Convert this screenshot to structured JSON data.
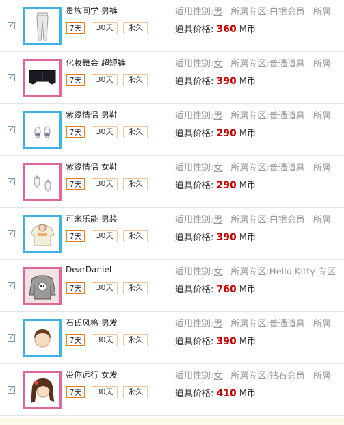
{
  "gender_label": "适用性别:",
  "zone_label": "所属专区:",
  "price_label": "道具价格:",
  "currency": "M币",
  "durations": {
    "d7": "7天",
    "d30": "30天",
    "perm": "永久"
  },
  "checkbox_mark": "✓",
  "items": [
    {
      "name": "贵族同学 男裤",
      "gender": "男",
      "zone": "白银会员",
      "zone_next": "所属",
      "price": "360",
      "frame": "blue",
      "icon": "pants-icon"
    },
    {
      "name": "化妆舞会 超短裤",
      "gender": "女",
      "zone": "普通道具",
      "zone_next": "所属",
      "price": "390",
      "frame": "pink",
      "icon": "shorts-icon"
    },
    {
      "name": "紫缘情侣 男鞋",
      "gender": "男",
      "zone": "普通道具",
      "zone_next": "所属",
      "price": "290",
      "frame": "blue",
      "icon": "male-shoes-icon"
    },
    {
      "name": "紫缘情侣 女鞋",
      "gender": "女",
      "zone": "普通道具",
      "zone_next": "所属",
      "price": "290",
      "frame": "pink",
      "icon": "female-shoes-icon"
    },
    {
      "name": "可米乐能 男装",
      "gender": "男",
      "zone": "白银会员",
      "zone_next": "所属",
      "price": "390",
      "frame": "blue",
      "icon": "male-top-icon"
    },
    {
      "name": "DearDaniel",
      "gender": "女",
      "zone": "Hello Kitty 专区",
      "zone_next": "",
      "price": "760",
      "frame": "pink",
      "icon": "sweater-icon"
    },
    {
      "name": "石氏风格 男发",
      "gender": "男",
      "zone": "普通道具",
      "zone_next": "所属",
      "price": "390",
      "frame": "blue",
      "icon": "male-hair-icon"
    },
    {
      "name": "带你远行 女发",
      "gender": "女",
      "zone": "钻石会员",
      "zone_next": "所属",
      "price": "410",
      "frame": "pink",
      "icon": "female-hair-icon"
    }
  ]
}
